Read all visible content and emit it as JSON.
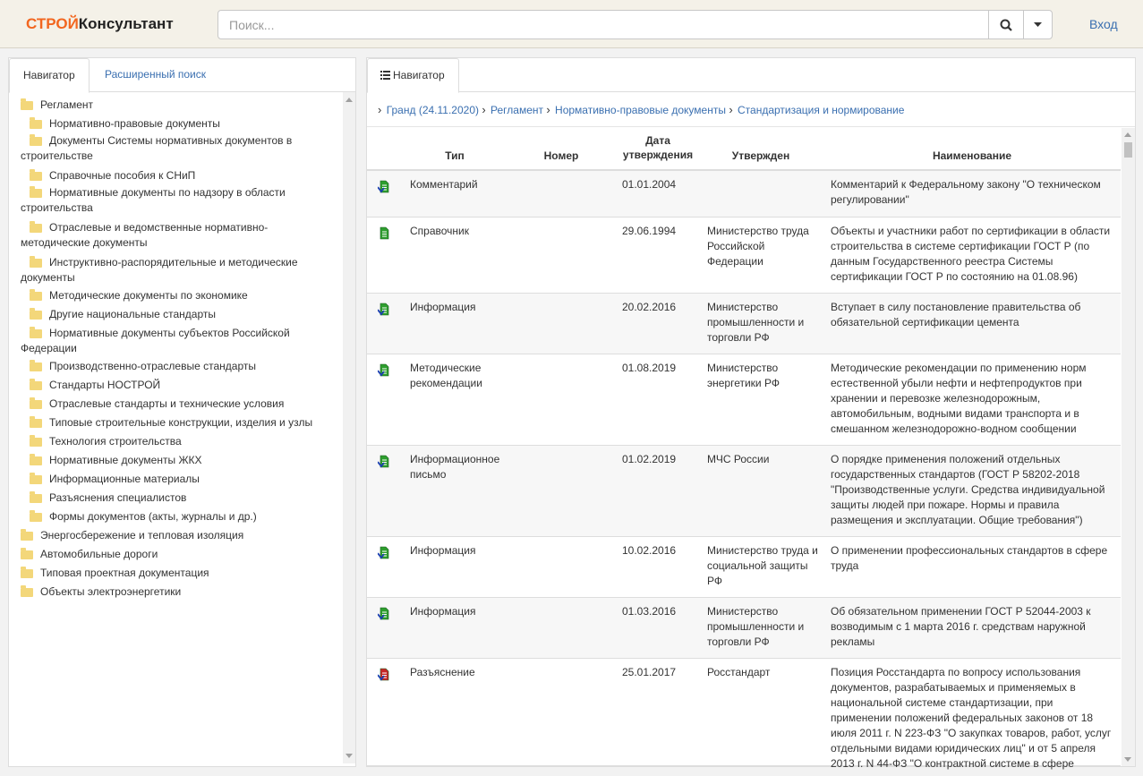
{
  "header": {
    "logo_part1": "СТРОЙ",
    "logo_part2": "Консультант",
    "search_placeholder": "Поиск...",
    "login": "Вход"
  },
  "left": {
    "tabs": [
      "Навигатор",
      "Расширенный поиск"
    ],
    "tree": [
      {
        "label": "Регламент",
        "level": 0,
        "open": true
      },
      {
        "label": "Нормативно-правовые документы",
        "level": 1
      },
      {
        "label": "Документы Системы нормативных документов в строительстве",
        "level": 1
      },
      {
        "label": "Справочные пособия к СНиП",
        "level": 1
      },
      {
        "label": "Нормативные документы по надзору в области строительства",
        "level": 1
      },
      {
        "label": "Отраслевые и ведомственные нормативно-методические документы",
        "level": 1
      },
      {
        "label": "Инструктивно-распорядительные и методические документы",
        "level": 1
      },
      {
        "label": "Методические документы по экономике",
        "level": 1
      },
      {
        "label": "Другие национальные стандарты",
        "level": 1
      },
      {
        "label": "Нормативные документы субъектов Российской Федерации",
        "level": 1
      },
      {
        "label": "Производственно-отраслевые стандарты",
        "level": 1
      },
      {
        "label": "Стандарты НОСТРОЙ",
        "level": 1
      },
      {
        "label": "Отраслевые стандарты и технические условия",
        "level": 1
      },
      {
        "label": "Типовые строительные конструкции, изделия и узлы",
        "level": 1
      },
      {
        "label": "Технология строительства",
        "level": 1
      },
      {
        "label": "Нормативные документы ЖКХ",
        "level": 1
      },
      {
        "label": "Информационные материалы",
        "level": 1
      },
      {
        "label": "Разъяснения специалистов",
        "level": 1
      },
      {
        "label": "Формы документов (акты, журналы и др.)",
        "level": 1
      },
      {
        "label": "Энергосбережение и тепловая изоляция",
        "level": 0
      },
      {
        "label": "Автомобильные дороги",
        "level": 0
      },
      {
        "label": "Типовая проектная документация",
        "level": 0
      },
      {
        "label": "Объекты электроэнергетики",
        "level": 0
      }
    ]
  },
  "right": {
    "tab": "Навигатор",
    "breadcrumb": [
      "Гранд (24.11.2020)",
      "Регламент",
      "Нормативно-правовые документы",
      "Стандартизация и нормирование"
    ],
    "columns": {
      "type": "Тип",
      "number": "Номер",
      "date": "Дата утверждения",
      "approved": "Утвержден",
      "name": "Наименование"
    },
    "rows": [
      {
        "icon": "doc-green-arrow",
        "type": "Комментарий",
        "number": "",
        "date": "01.01.2004",
        "approved": "",
        "name": "Комментарий к Федеральному закону \"О техническом регулировании\""
      },
      {
        "icon": "doc-green",
        "type": "Справочник",
        "number": "",
        "date": "29.06.1994",
        "approved": "Министерство труда Российской Федерации",
        "name": "Объекты и участники работ по сертификации в области строительства в системе сертификации ГОСТ Р (по данным Государственного реестра Системы сертификации ГОСТ Р по состоянию на 01.08.96)"
      },
      {
        "icon": "doc-green-arrow",
        "type": "Информация",
        "number": "",
        "date": "20.02.2016",
        "approved": "Министерство промышленности и торговли РФ",
        "name": "Вступает в силу постановление правительства об обязательной сертификации цемента"
      },
      {
        "icon": "doc-green-arrow",
        "type": "Методические рекомендации",
        "number": "",
        "date": "01.08.2019",
        "approved": "Министерство энергетики РФ",
        "name": "Методические рекомендации по применению норм естественной убыли нефти и нефтепродуктов при хранении и перевозке железнодорожным, автомобильным, водными видами транспорта и в смешанном железнодорожно-водном сообщении"
      },
      {
        "icon": "doc-green-arrow",
        "type": "Информационное письмо",
        "number": "",
        "date": "01.02.2019",
        "approved": "МЧС России",
        "name": "О порядке применения положений отдельных государственных стандартов (ГОСТ Р 58202-2018 \"Производственные услуги. Средства индивидуальной защиты людей при пожаре. Нормы и правила размещения и эксплуатации. Общие требования\")"
      },
      {
        "icon": "doc-green-arrow",
        "type": "Информация",
        "number": "",
        "date": "10.02.2016",
        "approved": "Министерство труда и социальной защиты РФ",
        "name": "О применении профессиональных стандартов в сфере труда"
      },
      {
        "icon": "doc-green-arrow",
        "type": "Информация",
        "number": "",
        "date": "01.03.2016",
        "approved": "Министерство промышленности и торговли РФ",
        "name": "Об обязательном применении ГОСТ Р 52044-2003 к возводимым с 1 марта 2016 г. средствам наружной рекламы"
      },
      {
        "icon": "doc-red-arrow",
        "type": "Разъяснение",
        "number": "",
        "date": "25.01.2017",
        "approved": "Росстандарт",
        "name": "Позиция Росстандарта по вопросу использования документов, разрабатываемых и применяемых в национальной системе стандартизации, при применении положений федеральных законов от 18 июля 2011 г. N 223-ФЗ \"О закупках товаров, работ, услуг отдельными видами юридических лиц\" и от 5 апреля 2013 г. N 44-ФЗ \"О контрактной системе в сфере"
      }
    ]
  }
}
